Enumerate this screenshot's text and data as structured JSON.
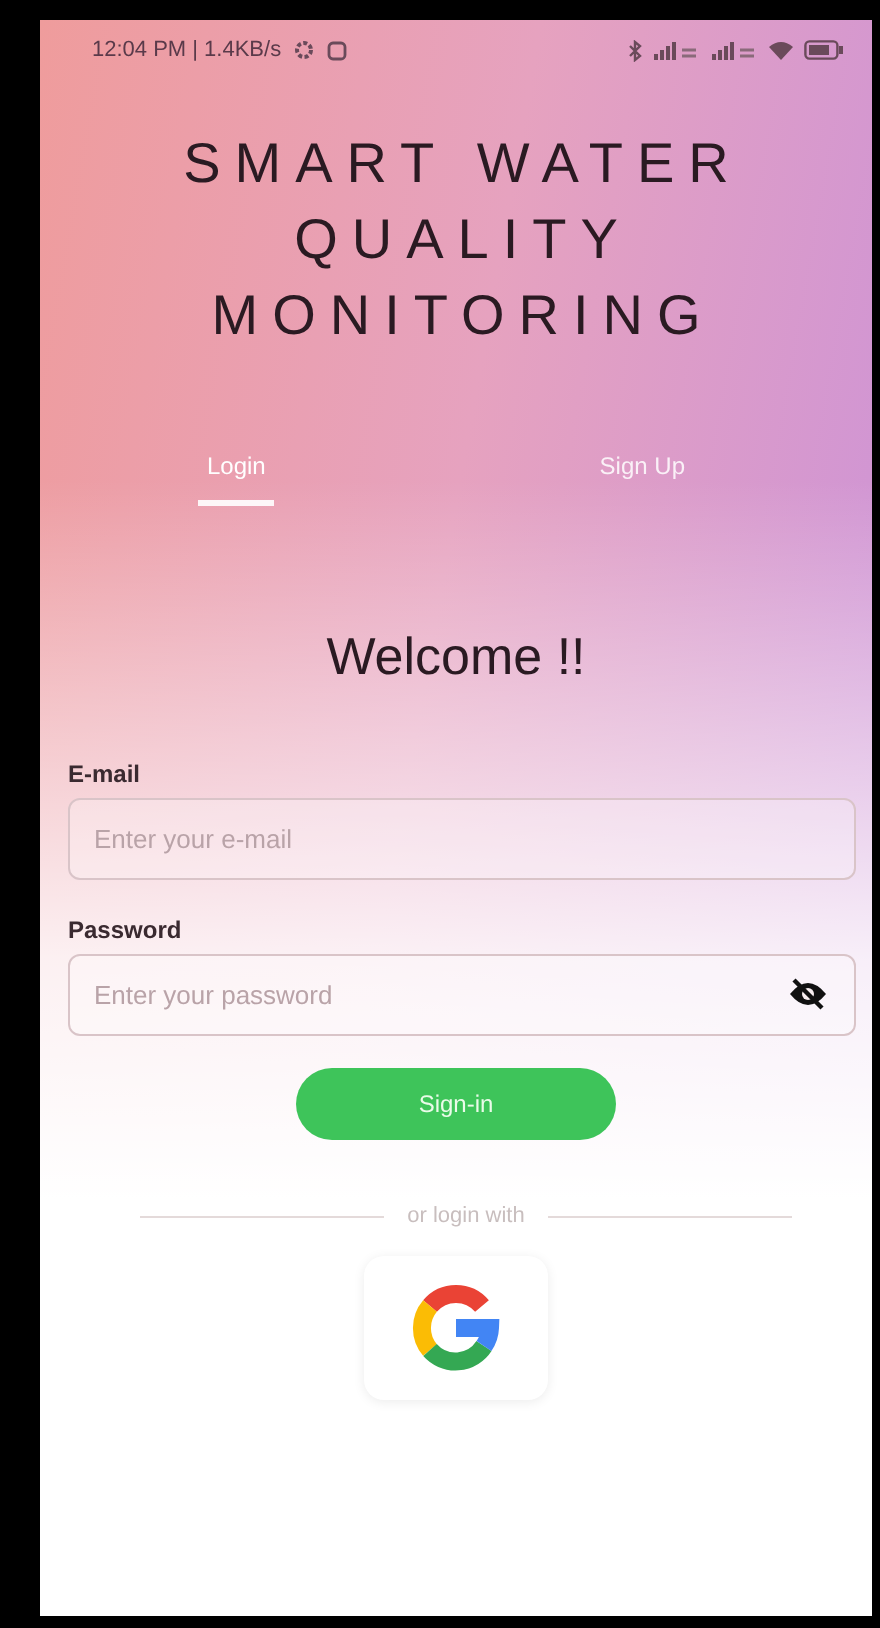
{
  "status_bar": {
    "time": "12:04 PM | 1.4KB/s"
  },
  "app_title": [
    "SMART WATER",
    "QUALITY",
    "MONITORING"
  ],
  "tabs": [
    {
      "label": "Login",
      "selected": true
    },
    {
      "label": "Sign Up",
      "selected": false
    }
  ],
  "heading": "Welcome !!",
  "fields": [
    {
      "kind": "email",
      "label": "E-mail",
      "placeholder": "Enter your e-mail"
    },
    {
      "kind": "password",
      "label": "Password",
      "placeholder": "Enter your password"
    }
  ],
  "submit": "Sign-in",
  "divider": "or login with"
}
